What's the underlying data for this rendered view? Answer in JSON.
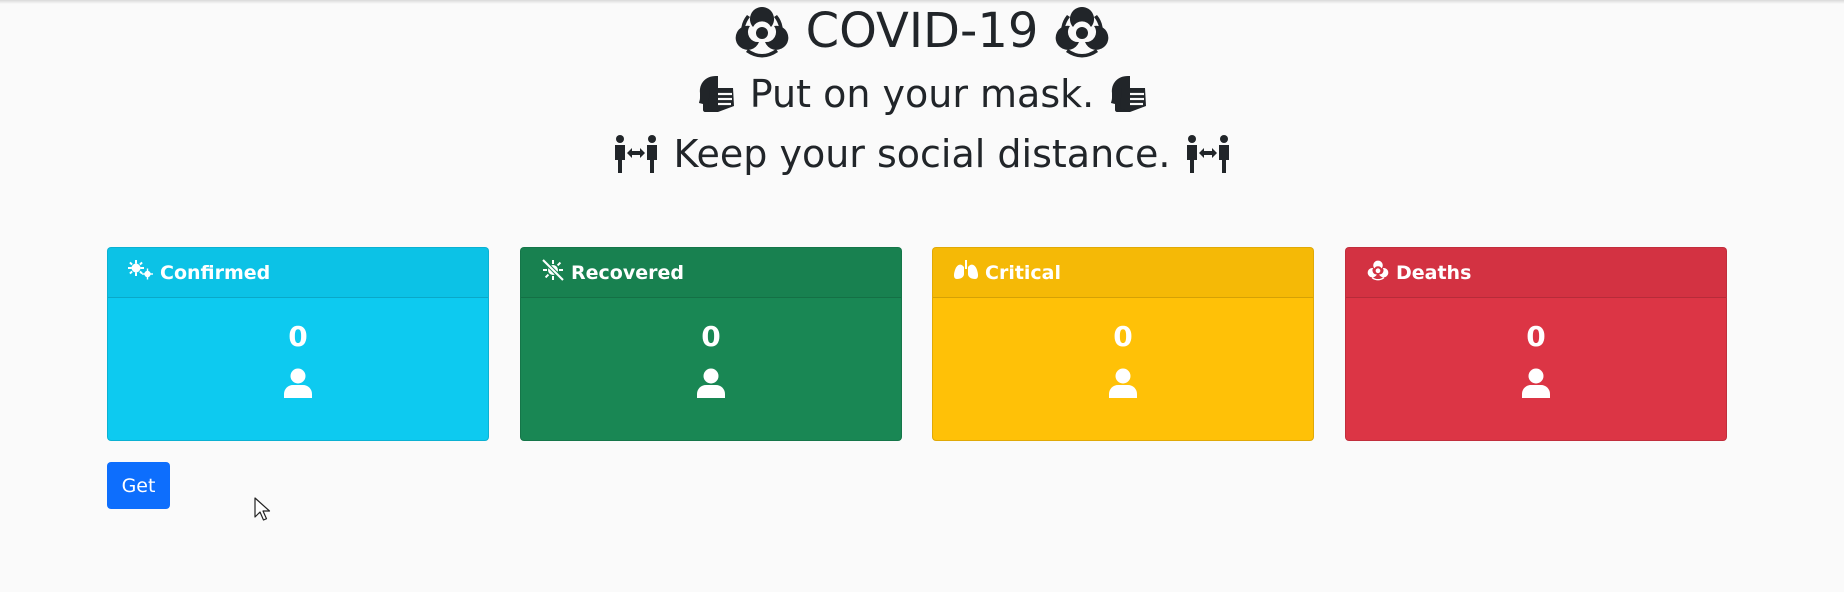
{
  "header": {
    "title": "COVID-19",
    "line2": "Put on your mask.",
    "line3": "Keep your social distance."
  },
  "cards": [
    {
      "label": "Confirmed",
      "value": "0",
      "color": "#0dcaf0",
      "icon": "virus-icon"
    },
    {
      "label": "Recovered",
      "value": "0",
      "color": "#198754",
      "icon": "virus-slash-icon"
    },
    {
      "label": "Critical",
      "value": "0",
      "color": "#ffc107",
      "icon": "lungs-icon"
    },
    {
      "label": "Deaths",
      "value": "0",
      "color": "#dc3545",
      "icon": "biohazard-icon"
    }
  ],
  "actions": {
    "get_label": "Get"
  },
  "icons": {
    "title": "biohazard-icon",
    "line2": "head-mask-icon",
    "line3": "people-arrows-icon",
    "card_footer": "user-icon"
  }
}
